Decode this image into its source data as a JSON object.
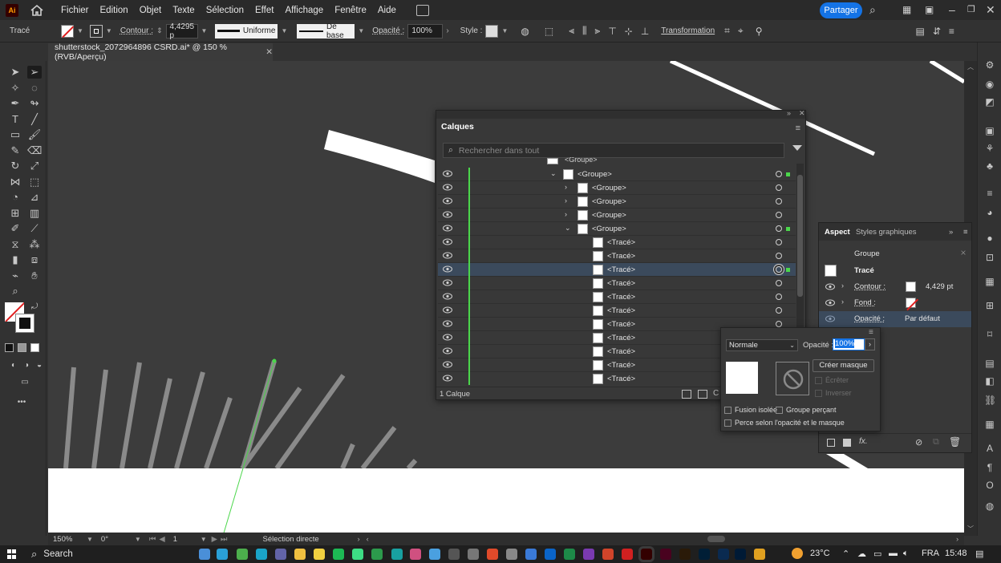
{
  "app": {
    "logo": "Ai",
    "menu": [
      "Fichier",
      "Edition",
      "Objet",
      "Texte",
      "Sélection",
      "Effet",
      "Affichage",
      "Fenêtre",
      "Aide"
    ],
    "share_label": "Partager"
  },
  "control_bar": {
    "object_type": "Tracé",
    "contour_label": "Contour :",
    "stroke_weight": "4,4295 p",
    "profile_label": "Uniforme",
    "brush_label": "De base",
    "opacity_label": "Opacité :",
    "opacity_value": "100%",
    "style_label": "Style :",
    "transform_label": "Transformation"
  },
  "document": {
    "tab_title": "shutterstock_2072964896 CSRD.ai* @ 150 % (RVB/Aperçu)",
    "close_glyph": "✕"
  },
  "status_bar": {
    "zoom": "150%",
    "rotation": "0°",
    "artboard_index": "1",
    "tool_name": "Sélection directe"
  },
  "layers_panel": {
    "title": "Calques",
    "search_placeholder": "Rechercher dans tout",
    "top_partial_row": "<Groupe>",
    "rows": [
      {
        "name": "<Groupe>",
        "indent": 1,
        "twisty": "⌄",
        "selected_square": true
      },
      {
        "name": "<Groupe>",
        "indent": 2,
        "twisty": "›",
        "selected_square": false
      },
      {
        "name": "<Groupe>",
        "indent": 2,
        "twisty": "›",
        "selected_square": false
      },
      {
        "name": "<Groupe>",
        "indent": 2,
        "twisty": "›",
        "selected_square": false
      },
      {
        "name": "<Groupe>",
        "indent": 2,
        "twisty": "⌄",
        "selected_square": true
      },
      {
        "name": "<Tracé>",
        "indent": 3,
        "twisty": "",
        "selected_square": false
      },
      {
        "name": "<Tracé>",
        "indent": 3,
        "twisty": "",
        "selected_square": false
      },
      {
        "name": "<Tracé>",
        "indent": 3,
        "twisty": "",
        "selected_square": true,
        "selected": true
      },
      {
        "name": "<Tracé>",
        "indent": 3,
        "twisty": "",
        "selected_square": false
      },
      {
        "name": "<Tracé>",
        "indent": 3,
        "twisty": "",
        "selected_square": false
      },
      {
        "name": "<Tracé>",
        "indent": 3,
        "twisty": "",
        "selected_square": false
      },
      {
        "name": "<Tracé>",
        "indent": 3,
        "twisty": "",
        "selected_square": false
      },
      {
        "name": "<Tracé>",
        "indent": 3,
        "twisty": "",
        "selected_square": false
      },
      {
        "name": "<Tracé>",
        "indent": 3,
        "twisty": "",
        "selected_square": false
      },
      {
        "name": "<Tracé>",
        "indent": 3,
        "twisty": "",
        "selected_square": false
      },
      {
        "name": "<Tracé>",
        "indent": 3,
        "twisty": "",
        "selected_square": false
      }
    ],
    "footer_count": "1 Calque"
  },
  "aspect_panel": {
    "tab_active": "Aspect",
    "tab_inactive": "Styles graphiques",
    "group_label": "Groupe",
    "path_label": "Tracé",
    "contour_label": "Contour :",
    "contour_value": "4,429 pt",
    "fill_label": "Fond :",
    "opacity_label": "Opacité :",
    "opacity_value": "Par défaut"
  },
  "opacity_popup": {
    "blend_mode": "Normale",
    "opacity_label": "Opacité :",
    "opacity_value": "100%",
    "create_mask": "Créer masque",
    "clip_label": "Écrêter",
    "invert_label": "Inverser",
    "isolate_blend": "Fusion isolée",
    "knockout_group": "Groupe perçant",
    "opacity_mask_define": "Perce selon l'opacité et le masque"
  },
  "taskbar": {
    "search_label": "Search",
    "temperature": "23°C",
    "language": "FRA",
    "time": "15:48"
  },
  "colors": {
    "accent": "#1473e6",
    "layer_color": "#4bd74b",
    "selection_row": "#3b4a5c",
    "canvas": "#3c3c3c"
  }
}
